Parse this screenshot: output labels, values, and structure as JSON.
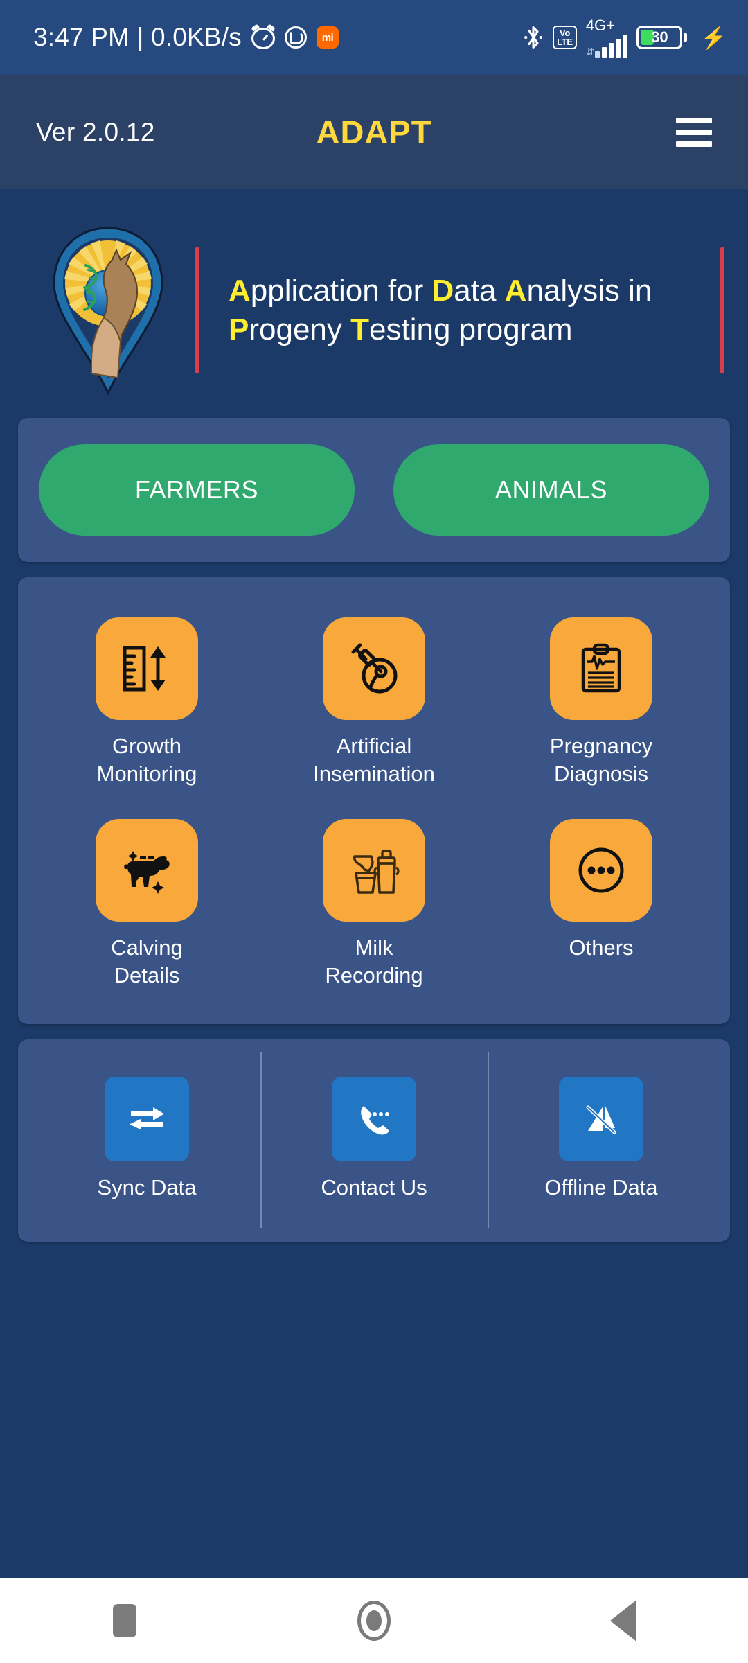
{
  "status_bar": {
    "time": "3:47 PM",
    "separator": "|",
    "network_speed": "0.0KB/s",
    "alarm_icon": "alarm-icon",
    "whatsapp_icon": "whatsapp-icon",
    "mi_badge": "mi",
    "bluetooth_icon": "bluetooth-icon",
    "volte_top": "Vo",
    "volte_bottom": "LTE",
    "network_type": "4G+",
    "battery_percent": "30",
    "charging_icon": "⚡"
  },
  "app_bar": {
    "version": "Ver 2.0.12",
    "title": "ADAPT",
    "menu_icon": "hamburger-menu-icon"
  },
  "hero": {
    "logo_icon": "adapt-logo-icon",
    "tagline_parts": [
      {
        "text": "A",
        "highlight": true
      },
      {
        "text": "pplication for ",
        "highlight": false
      },
      {
        "text": "D",
        "highlight": true
      },
      {
        "text": "ata ",
        "highlight": false
      },
      {
        "text": "A",
        "highlight": true
      },
      {
        "text": "nalysis in ",
        "highlight": false
      },
      {
        "text": "P",
        "highlight": true
      },
      {
        "text": "rogeny ",
        "highlight": false
      },
      {
        "text": "T",
        "highlight": true
      },
      {
        "text": "esting program",
        "highlight": false
      }
    ],
    "tagline_plain": "Application for Data Analysis in Progeny Testing program"
  },
  "actions": {
    "farmers_label": "FARMERS",
    "animals_label": "ANIMALS"
  },
  "modules": [
    {
      "label_line1": "Growth",
      "label_line2": "Monitoring",
      "icon": "ruler-arrows-icon"
    },
    {
      "label_line1": "Artificial",
      "label_line2": "Insemination",
      "icon": "syringe-sperm-icon"
    },
    {
      "label_line1": "Pregnancy",
      "label_line2": "Diagnosis",
      "icon": "clipboard-ecg-icon"
    },
    {
      "label_line1": "Calving",
      "label_line2": "Details",
      "icon": "cow-sparkle-icon"
    },
    {
      "label_line1": "Milk",
      "label_line2": "Recording",
      "icon": "milk-can-bucket-icon"
    },
    {
      "label_line1": "Others",
      "label_line2": "",
      "icon": "ellipsis-circle-icon"
    }
  ],
  "utilities": [
    {
      "label": "Sync Data",
      "icon": "sync-arrows-icon"
    },
    {
      "label": "Contact Us",
      "icon": "phone-dots-icon"
    },
    {
      "label": "Offline Data",
      "icon": "signal-off-icon"
    }
  ],
  "nav_bar": {
    "recents_icon": "recents-square-icon",
    "home_icon": "home-circle-icon",
    "back_icon": "back-triangle-icon"
  },
  "colors": {
    "page_bg": "#1c3a68",
    "app_bar_bg": "#2c4166",
    "status_bar_bg": "#264a80",
    "card_bg": "#3a5487",
    "brand_yellow": "#ffd83d",
    "highlight_yellow": "#ffee2e",
    "accent_green": "#2fa96e",
    "module_orange": "#f9a93c",
    "utility_blue": "#2277c4",
    "rule_red": "#d6404a",
    "battery_green": "#3ddc5c"
  }
}
